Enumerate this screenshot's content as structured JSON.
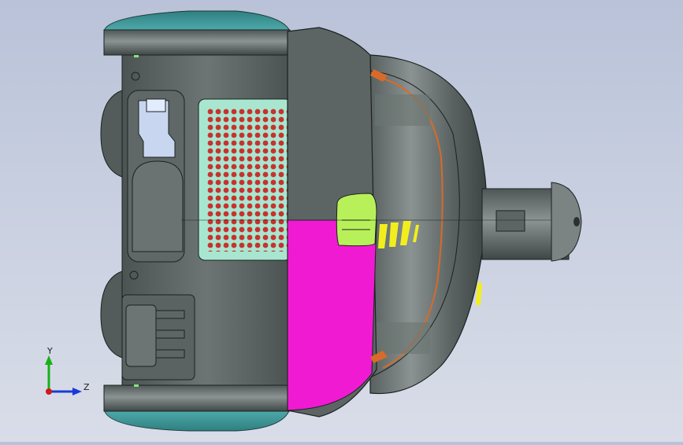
{
  "viewport": {
    "background_top": "#b9c2d8",
    "background_bottom": "#d9dde8"
  },
  "model": {
    "body_color": "#5d6664",
    "cap_color": "#3f9a9b",
    "grille_color": "#a8e6d0",
    "grille_dot_color": "#c8322e",
    "highlight_face_color": "#f01ad2",
    "green_tab_color": "#b8f05a",
    "yellow_mark_color": "#f2ee1e",
    "orange_accent_color": "#d86a2a",
    "clip_color": "#c9d6f0"
  },
  "triad": {
    "y_label": "Y",
    "z_label": "Z",
    "y_color": "#18b018",
    "z_color": "#1a3ad8",
    "origin_color": "#d01818"
  }
}
